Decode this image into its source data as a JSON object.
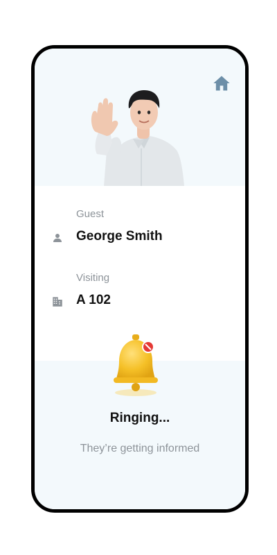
{
  "colors": {
    "hero_bg": "#f3f9fc",
    "label": "#8d9399",
    "value": "#111111",
    "home_icon": "#6d8fa8",
    "bell": "#f5c027",
    "notice": "#e53935"
  },
  "header": {
    "home_icon": "home-icon"
  },
  "guest": {
    "label": "Guest",
    "icon": "person-icon",
    "name": "George Smith"
  },
  "visiting": {
    "label": "Visiting",
    "icon": "building-icon",
    "unit": "A 102"
  },
  "status": {
    "icon": "bell-icon",
    "title": "Ringing...",
    "subtitle": "They’re getting informed"
  }
}
